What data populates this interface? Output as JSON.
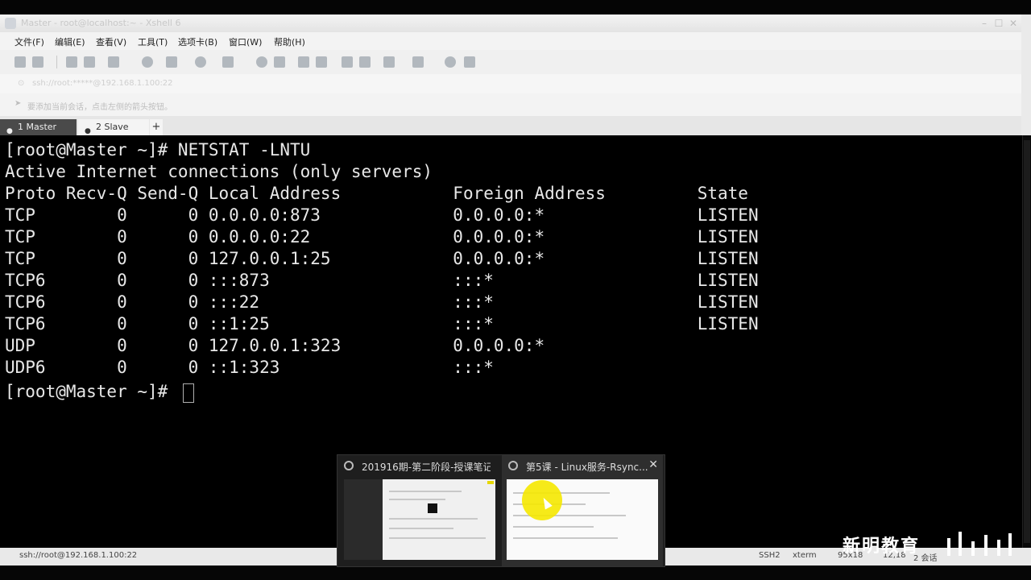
{
  "window": {
    "title": "Master - root@localhost:~ - Xshell 6"
  },
  "menu": [
    "文件(F)",
    "编辑(E)",
    "查看(V)",
    "工具(T)",
    "选项卡(B)",
    "窗口(W)",
    "帮助(H)"
  ],
  "address": "ssh://root:*****@192.168.1.100:22",
  "infobar": "要添加当前会话，点击左侧的箭头按钮。",
  "tabs": [
    {
      "label": "1 Master",
      "active": true
    },
    {
      "label": "2 Slave",
      "active": false
    }
  ],
  "tab_add": "+",
  "terminal": {
    "lines": [
      "[root@Master ~]# NETSTAT -LNTU",
      "Active Internet connections (only servers)",
      "Proto Recv-Q Send-Q Local Address           Foreign Address         State",
      "TCP        0      0 0.0.0.0:873             0.0.0.0:*               LISTEN",
      "TCP        0      0 0.0.0.0:22              0.0.0.0:*               LISTEN",
      "TCP        0      0 127.0.0.1:25            0.0.0.0:*               LISTEN",
      "TCP6       0      0 :::873                  :::*                    LISTEN",
      "TCP6       0      0 :::22                   :::*                    LISTEN",
      "TCP6       0      0 ::1:25                  :::*                    LISTEN",
      "UDP        0      0 127.0.0.1:323           0.0.0.0:*",
      "UDP6       0      0 ::1:323                 :::*",
      "[root@Master ~]# "
    ]
  },
  "statusbar": {
    "connection": "ssh://root@192.168.1.100:22",
    "protocol": "SSH2",
    "term": "xterm",
    "size": "95x18",
    "position": "12,18",
    "sessions": "2 会话"
  },
  "taskbar_popup": {
    "cards": [
      {
        "title": "201916期-第二阶段-授课笔记 ..."
      },
      {
        "title": "第5课 - Linux服务-Rsync..."
      }
    ],
    "close": "✕"
  },
  "watermark": "新明教育",
  "colors": {
    "terminal_bg": "#000000",
    "terminal_fg": "#e8e8e8",
    "highlight": "#f5e800"
  }
}
